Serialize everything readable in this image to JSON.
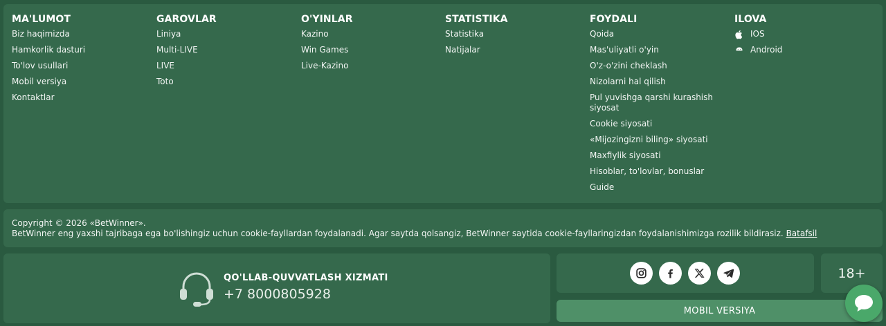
{
  "columns": [
    {
      "title": "MA'LUMOT",
      "items": [
        "Biz haqimizda",
        "Hamkorlik dasturi",
        "To'lov usullari",
        "Mobil versiya",
        "Kontaktlar"
      ]
    },
    {
      "title": "GAROVLAR",
      "items": [
        "Liniya",
        "Multi-LIVE",
        "LIVE",
        "Toto"
      ]
    },
    {
      "title": "O'YINLAR",
      "items": [
        "Kazino",
        "Win Games",
        "Live-Kazino"
      ]
    },
    {
      "title": "STATISTIKA",
      "items": [
        "Statistika",
        "Natijalar"
      ]
    },
    {
      "title": "FOYDALI",
      "items": [
        "Qoida",
        "Mas'uliyatli o'yin",
        "O'z-o'zini cheklash",
        "Nizolarni hal qilish",
        "Pul yuvishga qarshi kurashish siyosat",
        "Cookie siyosati",
        "«Mijozingizni biling» siyosati",
        "Maxfiylik siyosati",
        "Hisoblar, to'lovlar, bonuslar",
        "Guide"
      ]
    },
    {
      "title": "ILOVA",
      "items": [
        "IOS",
        "Android"
      ]
    }
  ],
  "footer": {
    "copyright": "Copyright © 2026 «BetWinner».",
    "cookie_text": "BetWinner eng yaxshi tajribaga ega bo'lishingiz uchun cookie-fayllardan foydalanadi. Agar saytda qolsangiz, BetWinner saytida cookie-fayllaringizdan foydalanishimizga rozilik bildirasiz.",
    "cookie_link": "Batafsil"
  },
  "support": {
    "title": "QO'LLAB-QUVVATLASH XIZMATI",
    "phone": "+7 8000805928",
    "icon": "headset-icon"
  },
  "social": [
    "instagram-icon",
    "facebook-icon",
    "x-icon",
    "telegram-icon"
  ],
  "age": "18+",
  "mobile_button": "MOBIL VERSIYA",
  "colors": {
    "background": "#2a5a40",
    "panel": "#35694c",
    "button": "#4f9068",
    "chat": "#4aa86a"
  }
}
